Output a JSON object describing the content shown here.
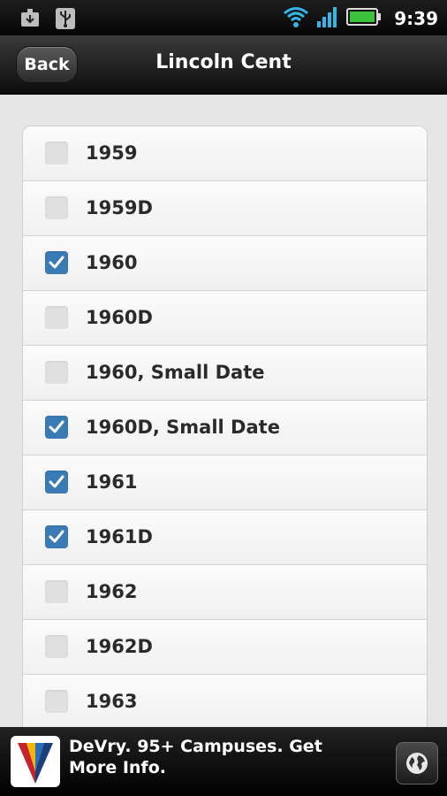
{
  "status_bar": {
    "time": "9:39",
    "icons": [
      "download-icon",
      "usb-icon",
      "wifi-icon",
      "signal-icon",
      "battery-icon"
    ]
  },
  "header": {
    "back_label": "Back",
    "title": "Lincoln Cent"
  },
  "list": {
    "items": [
      {
        "label": "1959",
        "checked": false
      },
      {
        "label": "1959D",
        "checked": false
      },
      {
        "label": "1960",
        "checked": true
      },
      {
        "label": "1960D",
        "checked": false
      },
      {
        "label": "1960, Small Date",
        "checked": false
      },
      {
        "label": "1960D, Small Date",
        "checked": true
      },
      {
        "label": "1961",
        "checked": true
      },
      {
        "label": "1961D",
        "checked": true
      },
      {
        "label": "1962",
        "checked": false
      },
      {
        "label": "1962D",
        "checked": false
      },
      {
        "label": "1963",
        "checked": false
      }
    ]
  },
  "ad": {
    "text": "DeVry. 95+ Campuses. Get More Info.",
    "logo_icon": "devry-logo-icon",
    "action_icon": "globe-icon"
  },
  "colors": {
    "checkbox_checked": "#3a7ab5",
    "checkbox_unchecked": "#e0e0e0",
    "battery": "#39c23a",
    "wifi": "#33b5e5"
  }
}
